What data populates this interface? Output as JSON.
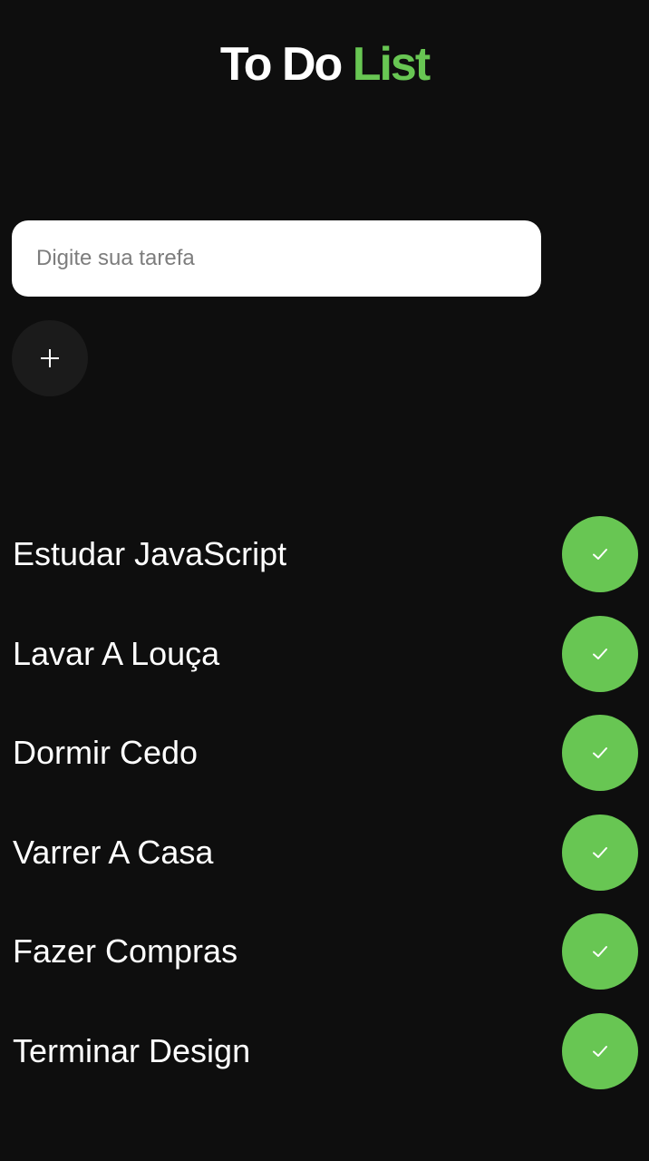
{
  "colors": {
    "accent": "#68c653",
    "background": "#0e0e0e",
    "add_button_bg": "#1b1b1b"
  },
  "header": {
    "title_part1": "To Do",
    "title_part2": "List"
  },
  "input": {
    "placeholder": "Digite sua tarefa",
    "value": ""
  },
  "add_button": {
    "icon": "plus-icon"
  },
  "tasks": [
    {
      "label": "Estudar JavaScript",
      "icon": "check-icon"
    },
    {
      "label": "Lavar A Louça",
      "icon": "check-icon"
    },
    {
      "label": "Dormir Cedo",
      "icon": "check-icon"
    },
    {
      "label": "Varrer A Casa",
      "icon": "check-icon"
    },
    {
      "label": "Fazer Compras",
      "icon": "check-icon"
    },
    {
      "label": "Terminar Design",
      "icon": "check-icon"
    }
  ]
}
